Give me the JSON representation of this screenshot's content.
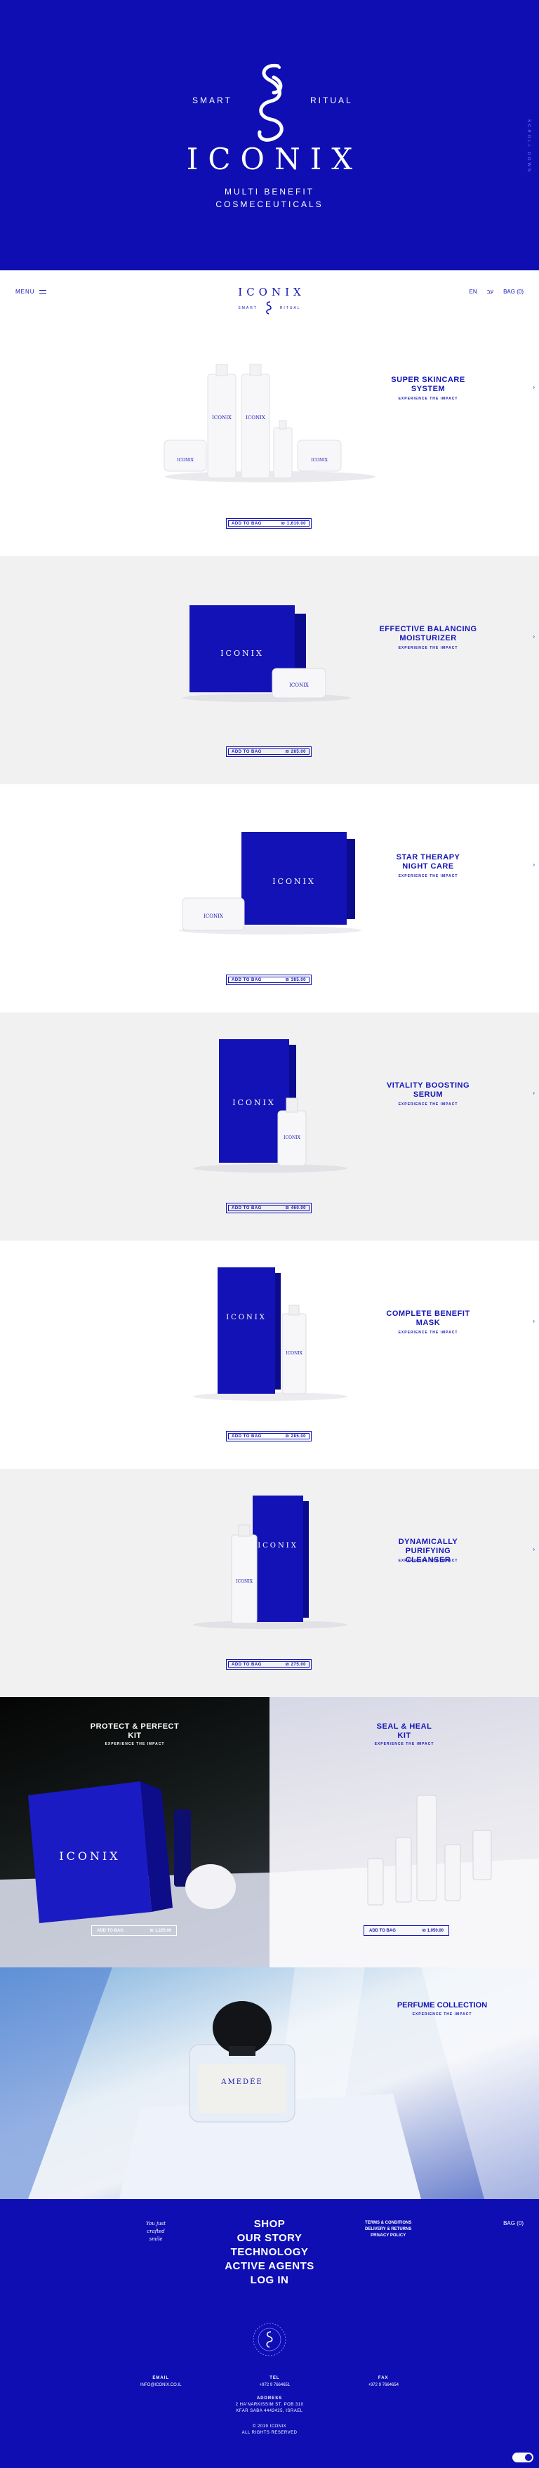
{
  "hero": {
    "left": "SMART",
    "right": "RITUAL",
    "logo": "ICONIX",
    "tagline1": "MULTI BENEFIT",
    "tagline2": "COSMECEUTICALS",
    "side": "SCROLL DOWN"
  },
  "nav": {
    "menu": "MENU",
    "brand": "ICONIX",
    "sub_left": "SMART",
    "sub_right": "RITUAL",
    "lang_en": "EN",
    "lang_he": "עב",
    "bag": "BAG (0)"
  },
  "products": [
    {
      "title1": "SUPER SKINCARE",
      "title2": "SYSTEM",
      "exp": "EXPERIENCE THE IMPACT",
      "cart": "ADD TO BAG",
      "price": "₪ 1,610.00"
    },
    {
      "title1": "EFFECTIVE BALANCING",
      "title2": "MOISTURIZER",
      "exp": "EXPERIENCE THE IMPACT",
      "cart": "ADD TO BAG",
      "price": "₪ 285.00"
    },
    {
      "title1": "STAR THERAPY",
      "title2": "NIGHT CARE",
      "exp": "EXPERIENCE THE IMPACT",
      "cart": "ADD TO BAG",
      "price": "₪ 385.00"
    },
    {
      "title1": "VITALITY BOOSTING",
      "title2": "SERUM",
      "exp": "EXPERIENCE THE IMPACT",
      "cart": "ADD TO BAG",
      "price": "₪ 460.00"
    },
    {
      "title1": "COMPLETE BENEFIT",
      "title2": "MASK",
      "exp": "EXPERIENCE THE IMPACT",
      "cart": "ADD TO BAG",
      "price": "₪ 285.00"
    },
    {
      "title1": "DYNAMICALLY PURIFYING",
      "title2": "CLEANSER",
      "exp": "EXPERIENCE THE IMPACT",
      "cart": "ADD TO BAG",
      "price": "₪ 275.00"
    }
  ],
  "kits": [
    {
      "title1": "PROTECT & PERFECT",
      "title2": "KIT",
      "exp": "EXPERIENCE THE IMPACT",
      "cart": "ADD TO BAG",
      "price": "₪ 1,225.00"
    },
    {
      "title1": "SEAL & HEAL",
      "title2": "KIT",
      "exp": "EXPERIENCE THE IMPACT",
      "cart": "ADD TO BAG",
      "price": "₪ 1,050.00"
    }
  ],
  "perfume": {
    "title": "PERFUME COLLECTION",
    "exp": "EXPERIENCE THE IMPACT",
    "bottle_label": "AMEDÉE"
  },
  "footer": {
    "script1": "You just",
    "script2": "crafted",
    "script3": "smile",
    "links": [
      "SHOP",
      "OUR STORY",
      "TECHNOLOGY",
      "ACTIVE AGENTS",
      "LOG IN"
    ],
    "legal": [
      "TERMS & CONDITIONS",
      "DELIVERY & RETURNS",
      "PRIVACY POLICY"
    ],
    "bag": "BAG (0)",
    "email_label": "EMAIL",
    "email": "INFO@ICONIX.CO.IL",
    "tel_label": "TEL",
    "tel": "+972 9 7664651",
    "fax_label": "FAX",
    "fax": "+972 9 7664654",
    "address_label": "ADDRESS",
    "address1": "2 HA'NARKISSIM ST. POB 310",
    "address2": "KFAR SABA 4442425, ISRAEL",
    "copy1": "© 2019 ICONIX",
    "copy2": "ALL RIGHTS RESERVED"
  },
  "colors": {
    "brand_blue": "#1515b8",
    "hero_blue": "#0e0eb3",
    "gray_bg": "#f1f1f2"
  }
}
